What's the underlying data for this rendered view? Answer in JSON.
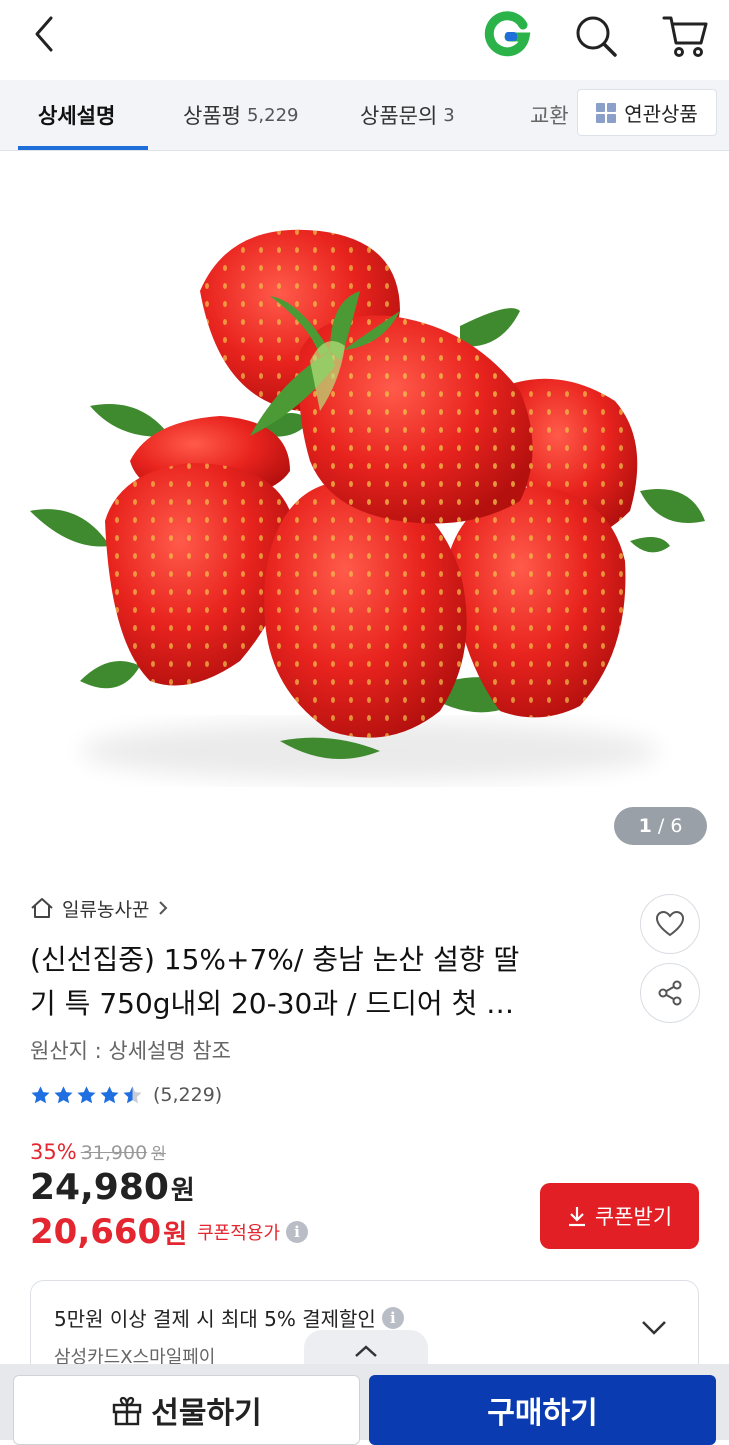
{
  "header": {
    "back_icon": "chevron-left-icon",
    "logo_letter": "G",
    "logo_colors": [
      "#e6262d",
      "#2bb34a",
      "#1e6fd9"
    ],
    "search_icon": "search-icon",
    "cart_icon": "cart-icon"
  },
  "tabs": [
    {
      "label": "상세설명",
      "count": ""
    },
    {
      "label": "상품평",
      "count": "5,229"
    },
    {
      "label": "상품문의",
      "count": "3"
    },
    {
      "label": "교환",
      "count": ""
    }
  ],
  "related_button": {
    "label": "연관상품"
  },
  "image": {
    "alt": "strawberries",
    "counter_current": "1",
    "counter_total": "6",
    "counter_sep": " / "
  },
  "product": {
    "seller": "일류농사꾼",
    "title_line1": "(신선집중) 15%+7%/ 충남 논산 설향 딸",
    "title_line2": "기 특 750g내외 20-30과 / 드디어 첫 …",
    "origin": "원산지 : 상세설명 참조",
    "rating": 4.5,
    "review_count": "(5,229)",
    "discount_pct": "35%",
    "original_price": "31,900",
    "original_unit": "원",
    "price": "24,980",
    "price_unit": "원",
    "coupon_price": "20,660",
    "coupon_unit": "원",
    "coupon_label": "쿠폰적용가",
    "coupon_button": "쿠폰받기"
  },
  "payment": {
    "text": "5만원 이상 결제 시 최대 5% 결제할인",
    "sub": "삼성카드X스마일페이"
  },
  "bottom": {
    "gift_label": "선물하기",
    "buy_label": "구매하기"
  },
  "colors": {
    "accent_blue": "#1e6fd9",
    "sale_red": "#e3262f",
    "buy_blue": "#0b3bb0",
    "star_blue": "#1f6fe0"
  }
}
